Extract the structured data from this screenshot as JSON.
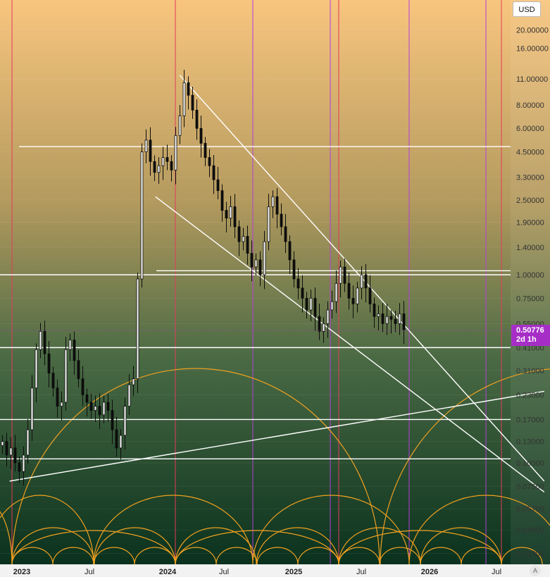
{
  "chart_data": {
    "type": "candlestick",
    "currency": "USD",
    "scale": "log",
    "ylim": [
      0.03,
      26
    ],
    "x_axis": {
      "labels": [
        "2023",
        "Jul",
        "2024",
        "Jul",
        "2025",
        "Jul",
        "2026",
        "Jul"
      ],
      "years": [
        "2023",
        "2024",
        "2025",
        "2026"
      ]
    },
    "y_axis": {
      "tick_labels": [
        "20.00000",
        "16.00000",
        "11.00000",
        "8.00000",
        "6.00000",
        "4.50000",
        "3.30000",
        "2.50000",
        "1.90000",
        "1.40000",
        "1.00000",
        "0.75000",
        "0.55000",
        "0.41000",
        "0.31000",
        "0.23000",
        "0.17000",
        "0.13000",
        "0.10000",
        "0.07500",
        "0.05700",
        "0.04400",
        "0.03300"
      ],
      "tick_values": [
        20,
        16,
        11,
        8,
        6,
        4.5,
        3.3,
        2.5,
        1.9,
        1.4,
        1.0,
        0.75,
        0.55,
        0.41,
        0.31,
        0.23,
        0.17,
        0.13,
        0.1,
        0.075,
        0.057,
        0.044,
        0.033
      ]
    },
    "last_price": {
      "value": "0.50776",
      "countdown": "2d 1h"
    },
    "candles_weekly_close": [
      0.13,
      0.11,
      0.12,
      0.1,
      0.09,
      0.11,
      0.15,
      0.25,
      0.4,
      0.5,
      0.38,
      0.3,
      0.25,
      0.2,
      0.21,
      0.4,
      0.45,
      0.35,
      0.28,
      0.23,
      0.21,
      0.19,
      0.2,
      0.18,
      0.21,
      0.19,
      0.15,
      0.12,
      0.14,
      0.2,
      0.26,
      0.28,
      0.95,
      4.5,
      5.2,
      4.0,
      3.5,
      3.8,
      4.2,
      4.0,
      3.6,
      5.5,
      7.0,
      10.5,
      9.0,
      7.5,
      6.0,
      5.0,
      4.2,
      3.8,
      3.2,
      2.8,
      2.2,
      2.0,
      2.3,
      1.8,
      1.5,
      1.6,
      1.3,
      1.1,
      1.2,
      1.0,
      1.5,
      2.3,
      2.6,
      2.1,
      1.8,
      1.5,
      1.2,
      0.95,
      0.85,
      0.75,
      0.65,
      0.75,
      0.6,
      0.5,
      0.55,
      0.65,
      0.72,
      0.9,
      1.1,
      0.9,
      0.75,
      0.7,
      0.85,
      1.0,
      0.85,
      0.7,
      0.6,
      0.62,
      0.55,
      0.6,
      0.58,
      0.55,
      0.62,
      0.51
    ],
    "horizontal_levels": [
      4.8,
      1.0,
      1.05,
      0.41,
      0.17,
      0.105
    ],
    "trendlines": [
      {
        "from": [
          "2024-02",
          11.5
        ],
        "to": [
          "2026-08",
          0.08
        ]
      },
      {
        "from": [
          "2023-12",
          2.6
        ],
        "to": [
          "2026-08",
          0.07
        ]
      },
      {
        "from": [
          "2022-12",
          0.08
        ],
        "to": [
          "2026-08",
          0.24
        ]
      }
    ],
    "colors": {
      "background_top": "#f7c57e",
      "background_bottom": "#062d1a",
      "vertical_red": "#e23a5a",
      "vertical_purple": "#b33ed6",
      "arcs": "#f0a020",
      "levels": "#ffffff",
      "badge": "#a62ec7"
    }
  },
  "ui": {
    "currency_label": "USD",
    "auto_label": "A"
  }
}
